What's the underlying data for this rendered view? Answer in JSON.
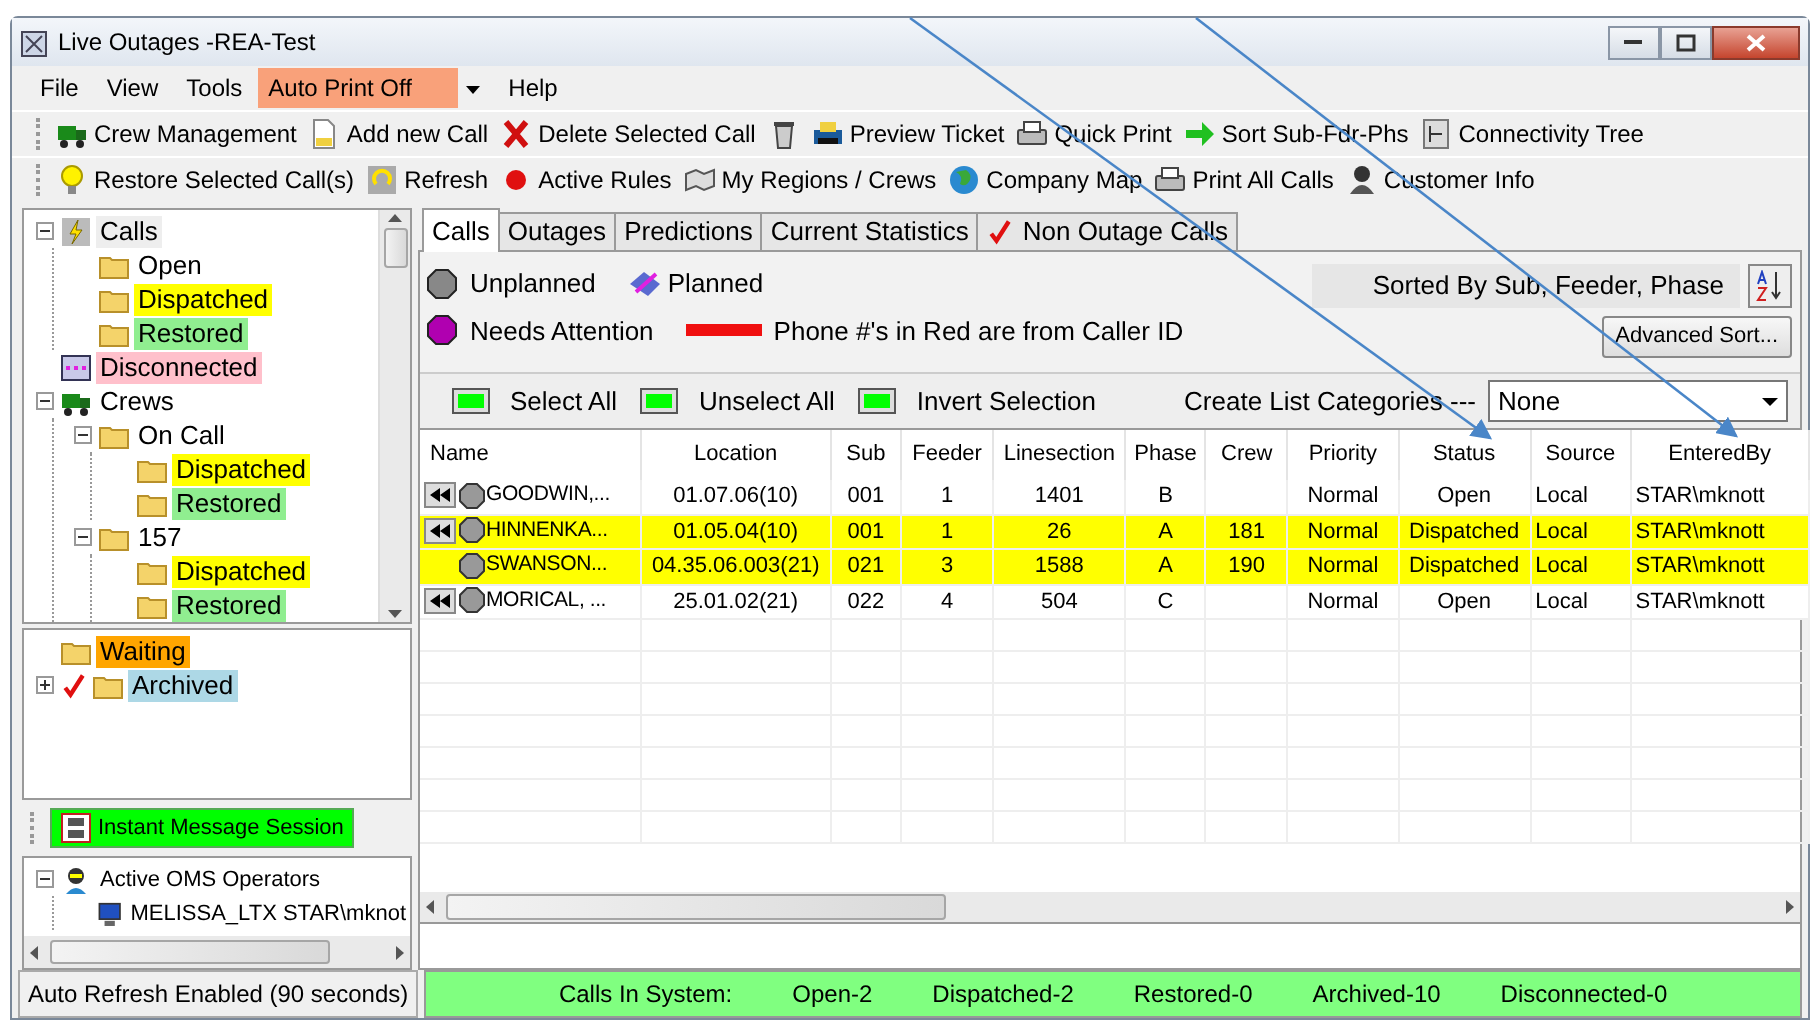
{
  "window": {
    "title": "Live Outages -REA-Test"
  },
  "menu": [
    {
      "label": "File",
      "kind": "menu"
    },
    {
      "label": "View",
      "kind": "menu"
    },
    {
      "label": "Tools",
      "kind": "menu"
    },
    {
      "label": "Auto Print Off",
      "kind": "dropdown"
    },
    {
      "label": "Help",
      "kind": "menu"
    }
  ],
  "toolbar_1": [
    {
      "label": "Crew Management",
      "kind": "truck"
    },
    {
      "label": "Add new Call",
      "kind": "page"
    },
    {
      "label": "Delete Selected Call",
      "kind": "delete"
    },
    {
      "kind": "trash"
    },
    {
      "label": "Preview Ticket",
      "kind": "ticket"
    },
    {
      "label": "Quick Print",
      "kind": "print"
    },
    {
      "label": "Sort  Sub-Fdr-Phs",
      "kind": "arrow"
    },
    {
      "label": "Connectivity Tree",
      "kind": "tree"
    }
  ],
  "toolbar_2": [
    {
      "label": "Restore Selected Call(s)",
      "kind": "bulb"
    },
    {
      "label": "Refresh",
      "kind": "refresh"
    },
    {
      "label": "Active Rules",
      "kind": "dot"
    },
    {
      "label": "My Regions / Crews",
      "kind": "map"
    },
    {
      "label": "Company Map",
      "kind": "globe"
    },
    {
      "label": "Print All Calls",
      "kind": "print"
    },
    {
      "label": "Customer Info",
      "kind": "person"
    }
  ],
  "tree": [
    {
      "label": "Calls",
      "kind": "bolt",
      "color": "#eeeeee",
      "expanded": true,
      "children": [
        {
          "label": "Open",
          "kind": "folder",
          "color": "#ffffff"
        },
        {
          "label": "Dispatched",
          "kind": "folder",
          "color": "#ffff00"
        },
        {
          "label": "Restored",
          "kind": "folder",
          "color": "#90ee90"
        }
      ]
    },
    {
      "label": "Disconnected",
      "kind": "plug",
      "color": "#ffc0cb"
    },
    {
      "label": "Crews",
      "kind": "truck",
      "color": "#ffffff",
      "expanded": true,
      "children": [
        {
          "label": "On Call",
          "kind": "folder",
          "color": "#ffffff",
          "expanded": true,
          "children": [
            {
              "label": "Dispatched",
              "kind": "folder",
              "color": "#ffff00"
            },
            {
              "label": "Restored",
              "kind": "folder",
              "color": "#90ee90"
            }
          ]
        },
        {
          "label": "157",
          "kind": "folder",
          "color": "#ffffff",
          "expanded": true,
          "children": [
            {
              "label": "Dispatched",
              "kind": "folder",
              "color": "#ffff00"
            },
            {
              "label": "Restored",
              "kind": "folder",
              "color": "#90ee90"
            }
          ]
        }
      ]
    }
  ],
  "tree_2": [
    {
      "label": "Waiting",
      "kind": "folder",
      "color": "#ffa500"
    },
    {
      "label": "Archived",
      "kind": "checkfolder",
      "color": "#add8e6",
      "expanded": false
    }
  ],
  "message_button": {
    "label": "Instant Message Session"
  },
  "operators": [
    {
      "label": "Active OMS Operators",
      "kind": "operator",
      "color": "#ffffff",
      "expanded": true,
      "children": [
        {
          "label": "MELISSA_LTX STAR\\mknot",
          "kind": "monitor",
          "color": "#ffffff"
        }
      ]
    }
  ],
  "tabs": [
    {
      "label": "Calls",
      "selected": true,
      "kind": "plain"
    },
    {
      "label": "Outages",
      "selected": false,
      "kind": "plain"
    },
    {
      "label": "Predictions",
      "selected": false,
      "kind": "plain"
    },
    {
      "label": "Current Statistics",
      "selected": false,
      "kind": "plain"
    },
    {
      "label": "Non Outage Calls",
      "selected": false,
      "kind": "check"
    }
  ],
  "legend": [
    {
      "label": "Unplanned",
      "kind": "grey"
    },
    {
      "label": "Planned",
      "kind": "planned"
    },
    {
      "label": "Needs Attention",
      "kind": "purple"
    },
    {
      "label": "Phone #'s in Red are from Caller ID",
      "kind": "redbar"
    }
  ],
  "sort_label": "Sorted By Sub, Feeder, Phase",
  "advanced_sort": "Advanced Sort...",
  "select_buttons": [
    "Select All",
    "Unselect All",
    "Invert Selection"
  ],
  "categories": {
    "label": "Create List Categories ---",
    "value": "None"
  },
  "table": {
    "columns": [
      "Name",
      "Location",
      "Sub",
      "Feeder",
      "Linesection",
      "Phase",
      "Crew",
      "Priority",
      "Status",
      "Source",
      "EnteredBy"
    ],
    "rows": [
      {
        "expand_button": true,
        "color": "#ffffff",
        "cells": [
          "GOODWIN,...",
          "01.07.06(10)",
          "001",
          "1",
          "1401",
          "B",
          "",
          "Normal",
          "Open",
          "Local",
          "STAR\\mknott"
        ]
      },
      {
        "expand_button": true,
        "color": "#ffff00",
        "cells": [
          "HINNENKA...",
          "01.05.04(10)",
          "001",
          "1",
          "26",
          "A",
          "181",
          "Normal",
          "Dispatched",
          "Local",
          "STAR\\mknott"
        ]
      },
      {
        "expand_button": false,
        "color": "#ffff00",
        "cells": [
          "SWANSON...",
          "04.35.06.003(21)",
          "021",
          "3",
          "1588",
          "A",
          "190",
          "Normal",
          "Dispatched",
          "Local",
          "STAR\\mknott"
        ]
      },
      {
        "expand_button": true,
        "color": "#ffffff",
        "cells": [
          "MORICAL, ...",
          "25.01.02(21)",
          "022",
          "4",
          "504",
          "C",
          "",
          "Normal",
          "Open",
          "Local",
          "STAR\\mknott"
        ]
      }
    ]
  },
  "status_bar": {
    "left": "Auto Refresh Enabled (90 seconds)",
    "items": [
      "Calls In System:",
      "Open-2",
      "Dispatched-2",
      "Restored-0",
      "Archived-10",
      "Disconnected-0"
    ]
  }
}
